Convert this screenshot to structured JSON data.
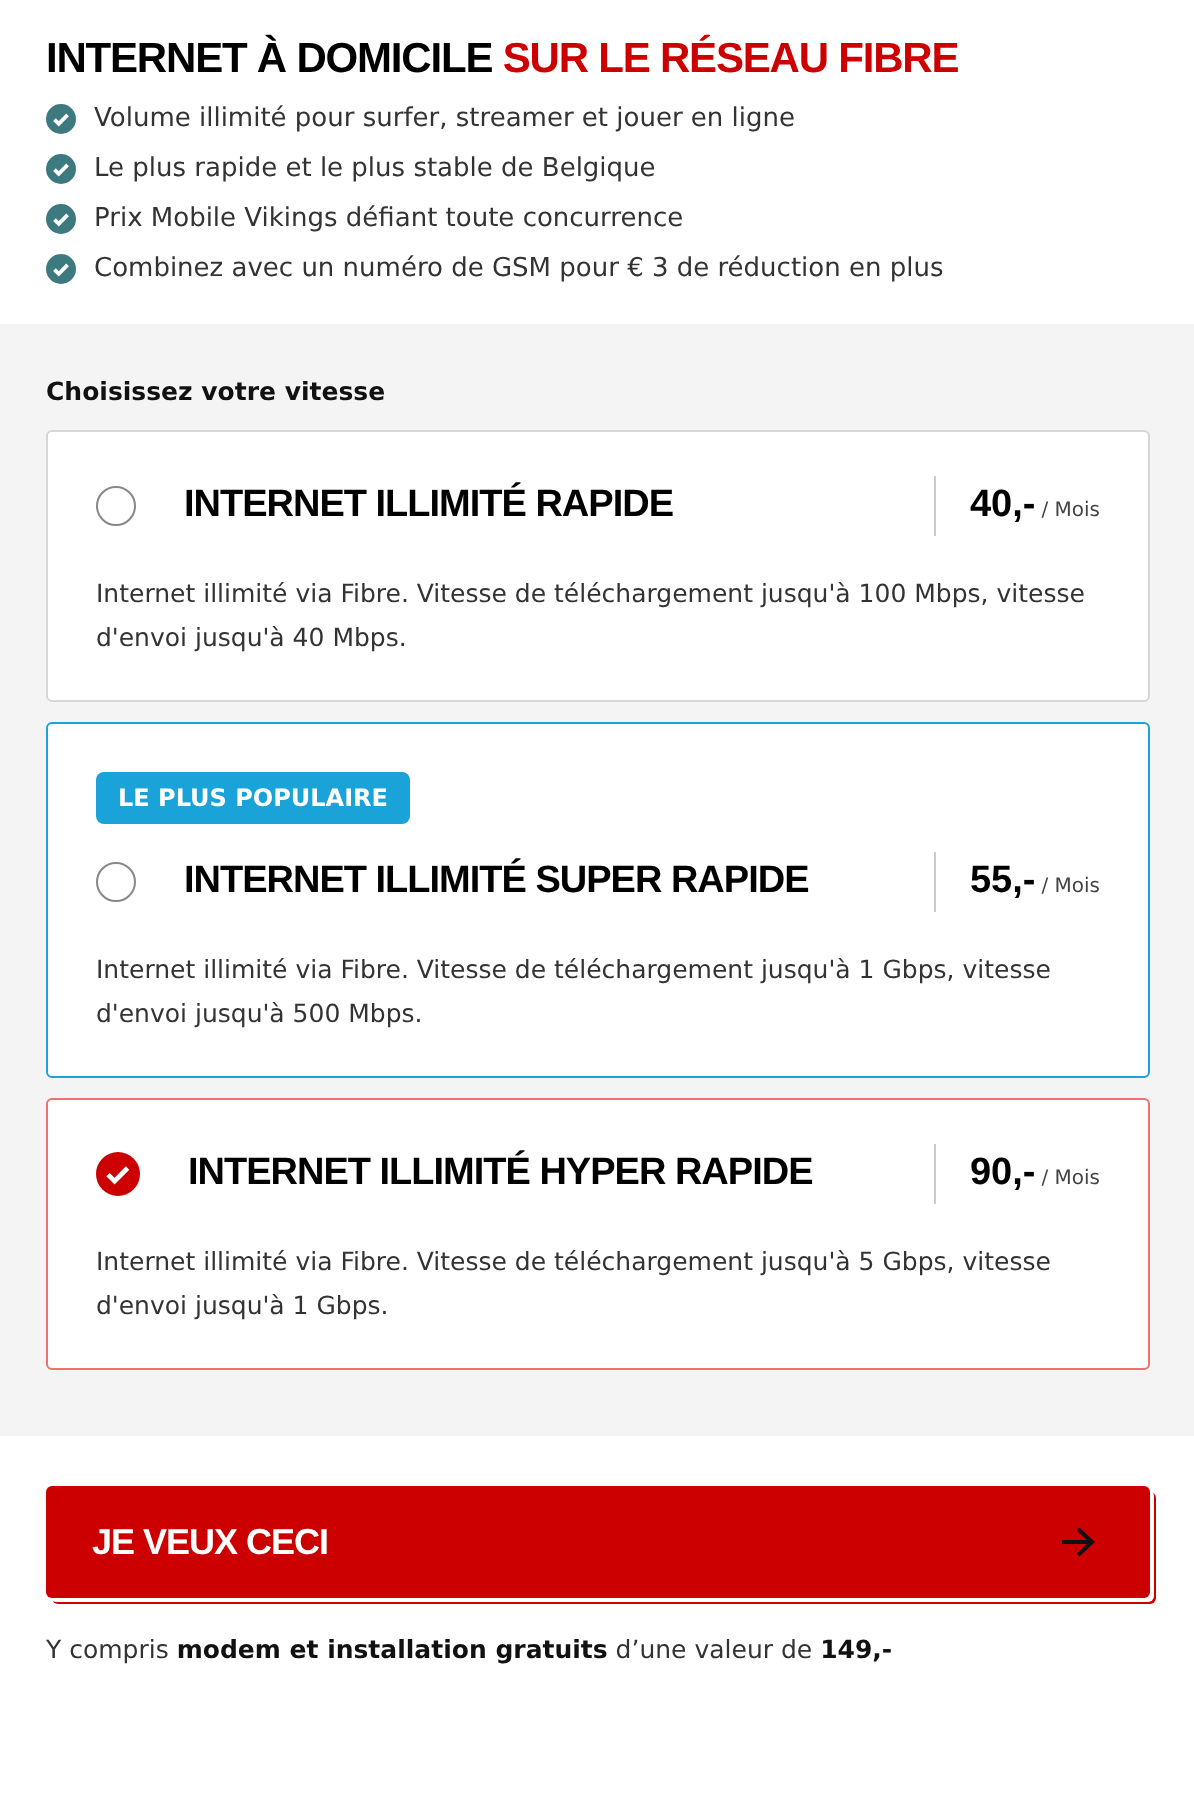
{
  "heading": {
    "main": "INTERNET À DOMICILE",
    "accent": "SUR LE RÉSEAU FIBRE"
  },
  "features": [
    "Volume illimité pour surfer, streamer et jouer en ligne",
    "Le plus rapide et le plus stable de Belgique",
    "Prix Mobile Vikings défiant toute concurrence",
    "Combinez avec un numéro de GSM pour € 3 de réduction en plus"
  ],
  "speed_label": "Choisissez votre vitesse",
  "plans": [
    {
      "title": "INTERNET ILLIMITÉ RAPIDE",
      "price": "40,-",
      "unit": "/ Mois",
      "description": "Internet illimité via Fibre. Vitesse de téléchargement jusqu'à 100 Mbps, vitesse d'envoi jusqu'à 40 Mbps.",
      "selected": false
    },
    {
      "badge": "LE PLUS POPULAIRE",
      "title": "INTERNET ILLIMITÉ SUPER RAPIDE",
      "price": "55,-",
      "unit": "/ Mois",
      "description": "Internet illimité via Fibre. Vitesse de téléchargement jusqu'à 1 Gbps, vitesse d'envoi jusqu'à 500 Mbps.",
      "selected": false
    },
    {
      "title": "INTERNET ILLIMITÉ HYPER RAPIDE",
      "price": "90,-",
      "unit": "/ Mois",
      "description": "Internet illimité via Fibre. Vitesse de téléchargement jusqu'à 5 Gbps, vitesse d'envoi jusqu'à 1 Gbps.",
      "selected": true
    }
  ],
  "cta": {
    "label": "JE VEUX CECI"
  },
  "note": "Y compris **modem et installation gratuits** d’une valeur de **149,-**"
}
